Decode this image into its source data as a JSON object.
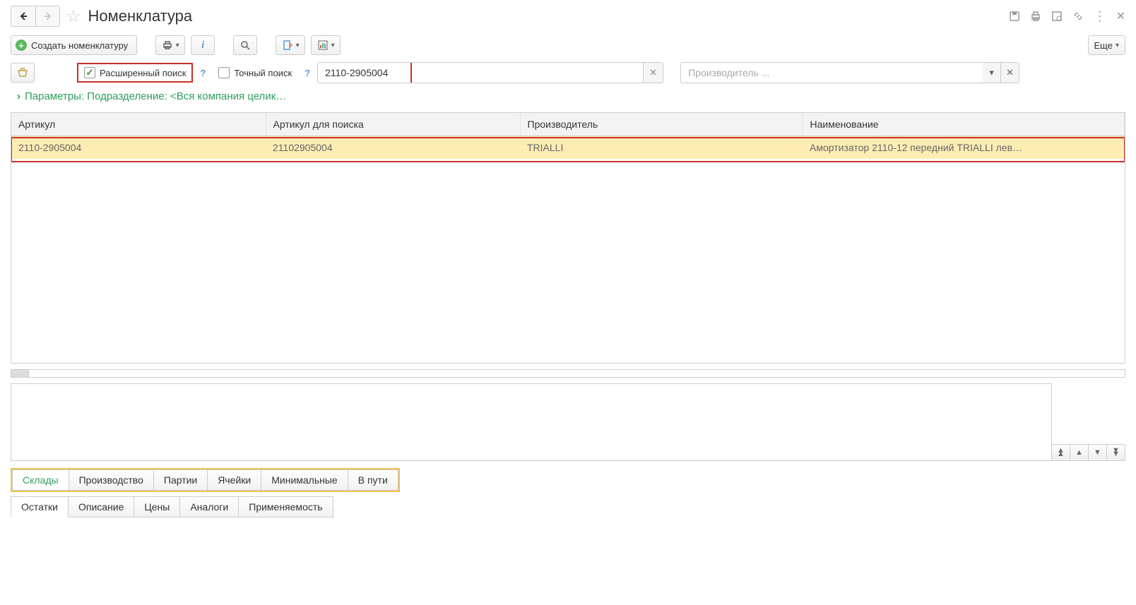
{
  "header": {
    "title": "Номенклатура"
  },
  "toolbar": {
    "create_label": "Создать номенклатуру",
    "more_label": "Еще"
  },
  "filters": {
    "extended_search_label": "Расширенный поиск",
    "extended_search_checked": true,
    "exact_search_label": "Точный поиск",
    "exact_search_checked": false,
    "search_value": "2110-2905004",
    "manufacturer_placeholder": "Производитель ..."
  },
  "params": {
    "text": "Параметры: Подразделение: <Вся компания целик…"
  },
  "table": {
    "columns": [
      "Артикул",
      "Артикул для поиска",
      "Производитель",
      "Наименование"
    ],
    "rows": [
      {
        "article": "2110-2905004",
        "search_article": "21102905004",
        "manufacturer": "TRIALLI",
        "name": "Амортизатор 2110-12 передний TRIALLI лев…"
      }
    ]
  },
  "tabs_upper": [
    {
      "label": "Склады",
      "active": true
    },
    {
      "label": "Производство",
      "active": false
    },
    {
      "label": "Партии",
      "active": false
    },
    {
      "label": "Ячейки",
      "active": false
    },
    {
      "label": "Минимальные",
      "active": false
    },
    {
      "label": "В пути",
      "active": false
    }
  ],
  "tabs_lower": [
    {
      "label": "Остатки",
      "active": true
    },
    {
      "label": "Описание",
      "active": false
    },
    {
      "label": "Цены",
      "active": false
    },
    {
      "label": "Аналоги",
      "active": false
    },
    {
      "label": "Применяемость",
      "active": false
    }
  ]
}
